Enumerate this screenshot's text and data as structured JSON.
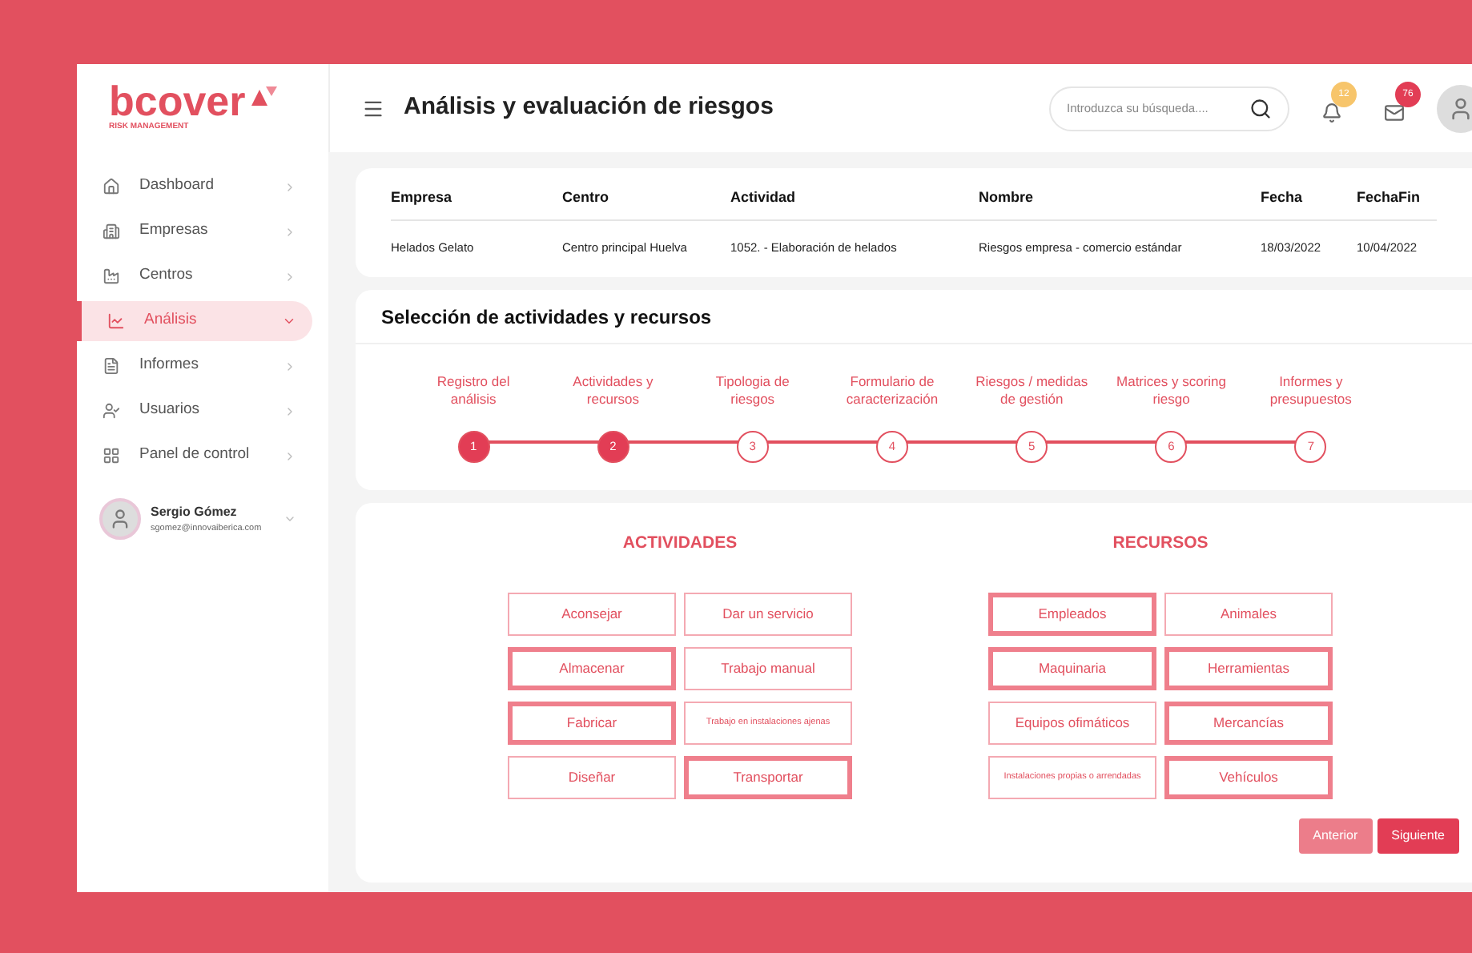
{
  "logo": {
    "name": "bcover",
    "tagline": "RISK MANAGEMENT"
  },
  "sidebar": {
    "items": [
      {
        "label": "Dashboard",
        "selected": false,
        "expanded": false
      },
      {
        "label": "Empresas",
        "selected": false,
        "expanded": false
      },
      {
        "label": "Centros",
        "selected": false,
        "expanded": false
      },
      {
        "label": "Análisis",
        "selected": true,
        "expanded": true
      },
      {
        "label": "Informes",
        "selected": false,
        "expanded": false
      },
      {
        "label": "Usuarios",
        "selected": false,
        "expanded": false
      },
      {
        "label": "Panel de control",
        "selected": false,
        "expanded": false
      }
    ],
    "user": {
      "name": "Sergio Gómez",
      "email": "sgomez@innovaiberica.com"
    }
  },
  "header": {
    "title": "Análisis y evaluación de riesgos",
    "search": {
      "placeholder": "Introduzca su búsqueda...."
    },
    "notifications": "12",
    "messages": "76"
  },
  "table": {
    "columns": [
      "Empresa",
      "Centro",
      "Actividad",
      "Nombre",
      "Fecha",
      "FechaFin"
    ],
    "rows": [
      [
        "Helados Gelato",
        "Centro principal Huelva",
        "1052. - Elaboración de helados",
        "Riesgos empresa - comercio estándar",
        "18/03/2022",
        "10/04/2022"
      ]
    ]
  },
  "section": {
    "title": "Selección de actividades y recursos"
  },
  "steps": [
    {
      "label": "Registro del análisis",
      "number": "1",
      "done": true
    },
    {
      "label": "Actividades y recursos",
      "number": "2",
      "done": true
    },
    {
      "label": "Tipologia de riesgos",
      "number": "3",
      "done": false
    },
    {
      "label": "Formulario de caracterización",
      "number": "4",
      "done": false
    },
    {
      "label": "Riesgos / medidas de gestión",
      "number": "5",
      "done": false
    },
    {
      "label": "Matrices y scoring riesgo",
      "number": "6",
      "done": false
    },
    {
      "label": "Informes y presupuestos",
      "number": "7",
      "done": false
    }
  ],
  "groups": [
    {
      "title": "ACTIVIDADES",
      "options": [
        {
          "label": "Aconsejar",
          "selected": false
        },
        {
          "label": "Dar un servicio",
          "selected": false
        },
        {
          "label": "Almacenar",
          "selected": true
        },
        {
          "label": "Trabajo manual",
          "selected": false
        },
        {
          "label": "Fabricar",
          "selected": true
        },
        {
          "label": "Trabajo en instalaciones ajenas",
          "selected": false
        },
        {
          "label": "Diseñar",
          "selected": false
        },
        {
          "label": "Transportar",
          "selected": true
        }
      ]
    },
    {
      "title": "RECURSOS",
      "options": [
        {
          "label": "Empleados",
          "selected": true
        },
        {
          "label": "Animales",
          "selected": false
        },
        {
          "label": "Maquinaria",
          "selected": true
        },
        {
          "label": "Herramientas",
          "selected": true
        },
        {
          "label": "Equipos ofimáticos",
          "selected": false
        },
        {
          "label": "Mercancías",
          "selected": true
        },
        {
          "label": "Instalaciones propias o arrendadas",
          "selected": false
        },
        {
          "label": "Vehículos",
          "selected": true
        }
      ]
    }
  ],
  "buttons": [
    {
      "label": "Anterior",
      "primary": false
    },
    {
      "label": "Siguiente",
      "primary": true
    }
  ]
}
